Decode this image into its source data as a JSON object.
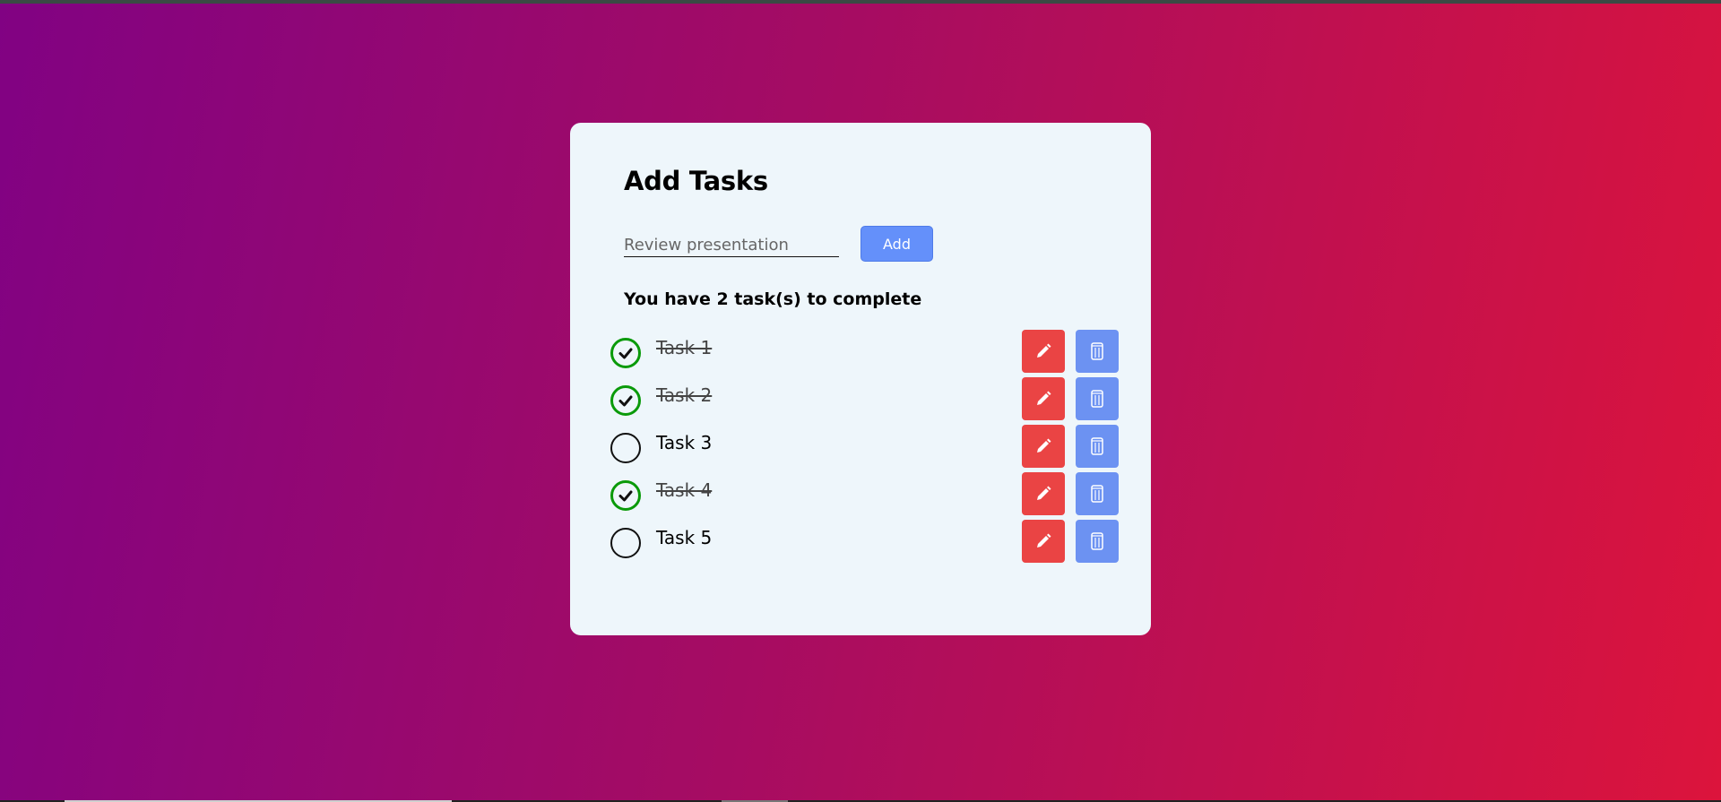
{
  "app": {
    "title": "Add Tasks"
  },
  "form": {
    "input_placeholder": "Review presentation",
    "input_value": "",
    "add_label": "Add"
  },
  "summary": {
    "text": "You have 2 task(s) to complete"
  },
  "tasks": [
    {
      "label": "Task 1",
      "completed": true
    },
    {
      "label": "Task 2",
      "completed": true
    },
    {
      "label": "Task 3",
      "completed": false
    },
    {
      "label": "Task 4",
      "completed": true
    },
    {
      "label": "Task 5",
      "completed": false
    }
  ],
  "icons": {
    "check": "check-circle-icon",
    "edit": "pencil-icon",
    "delete": "trash-can-icon"
  },
  "colors": {
    "edit_button": "#ea4444",
    "delete_button": "#6c92f2",
    "add_button": "#6490fa",
    "completed_check": "#0a9a0a"
  }
}
